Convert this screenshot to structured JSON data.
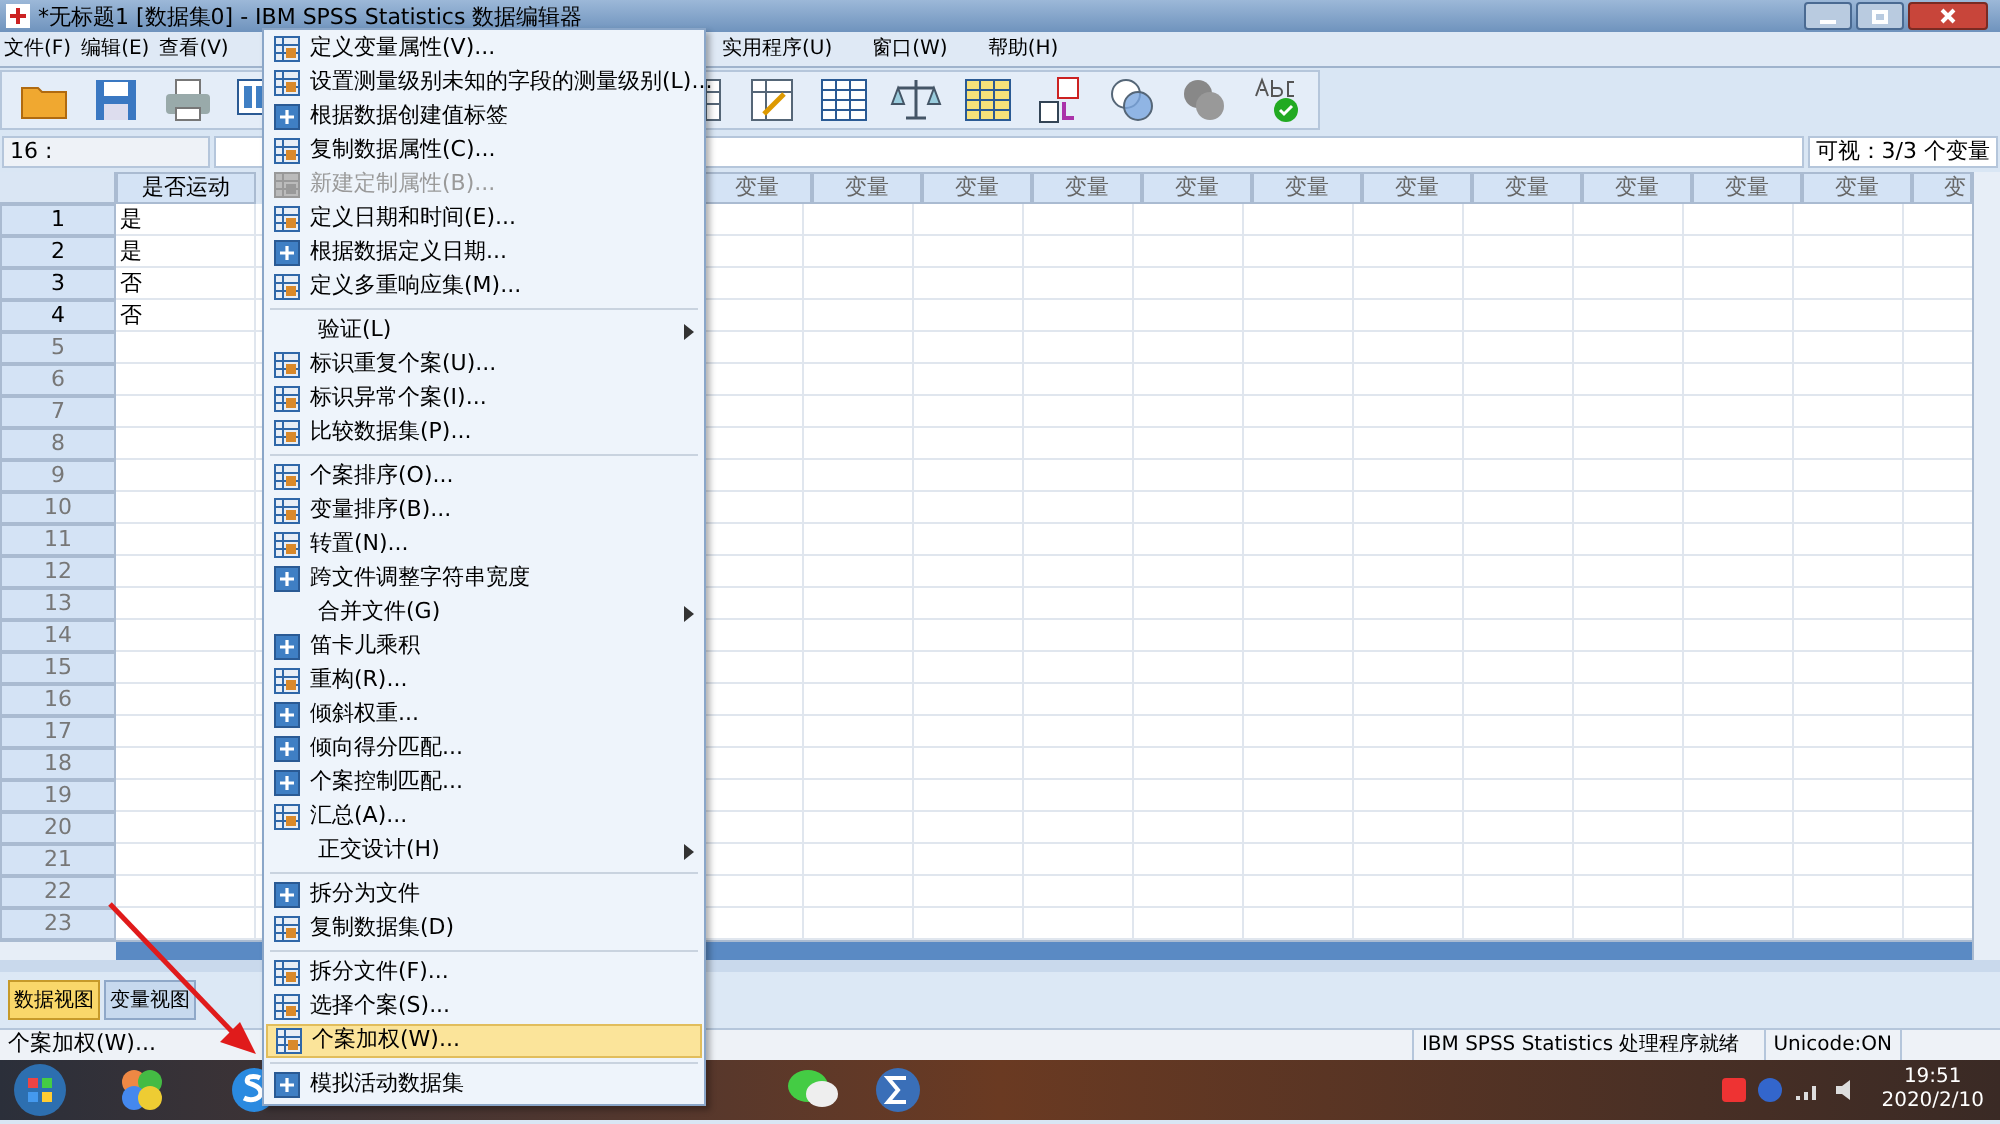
{
  "window": {
    "title": "*无标题1 [数据集0] - IBM SPSS Statistics 数据编辑器"
  },
  "menubar": {
    "left": [
      {
        "label": "文件(F)"
      },
      {
        "label": "编辑(E)"
      },
      {
        "label": "查看(V)"
      }
    ],
    "right": [
      {
        "label": "实用程序(U)"
      },
      {
        "label": "窗口(W)"
      },
      {
        "label": "帮助(H)"
      }
    ]
  },
  "cell_bar": {
    "reference": "16 :",
    "visible": "可视：3/3 个变量"
  },
  "grid": {
    "first_column": "是否运动",
    "columns": [
      "变量",
      "变量",
      "变量",
      "变量",
      "变量",
      "变量",
      "变量",
      "变量",
      "变量",
      "变量",
      "变量",
      "变"
    ],
    "row_numbers": [
      "1",
      "2",
      "3",
      "4",
      "5",
      "6",
      "7",
      "8",
      "9",
      "10",
      "11",
      "12",
      "13",
      "14",
      "15",
      "16",
      "17",
      "18",
      "19",
      "20",
      "21",
      "22",
      "23"
    ],
    "values": [
      "是",
      "是",
      "否",
      "否"
    ]
  },
  "view_tabs": [
    {
      "label": "数据视图",
      "selected": true
    },
    {
      "label": "变量视图",
      "selected": false
    }
  ],
  "status_bar": {
    "left": "个案加权(W)...",
    "processor": "IBM SPSS Statistics 处理程序就绪",
    "unicode": "Unicode:ON"
  },
  "menu": {
    "items": [
      {
        "kind": "tool",
        "label": "定义变量属性(V)...",
        "disabled": false,
        "selected": false
      },
      {
        "kind": "tool",
        "label": "设置测量级别未知的字段的测量级别(L)...",
        "disabled": false,
        "selected": false
      },
      {
        "kind": "plus",
        "label": "根据数据创建值标签",
        "disabled": false,
        "selected": false
      },
      {
        "kind": "tool",
        "label": "复制数据属性(C)...",
        "disabled": false,
        "selected": false
      },
      {
        "kind": "tool",
        "label": "新建定制属性(B)...",
        "disabled": true,
        "selected": false
      },
      {
        "kind": "tool",
        "label": "定义日期和时间(E)...",
        "disabled": false,
        "selected": false
      },
      {
        "kind": "plus",
        "label": "根据数据定义日期...",
        "disabled": false,
        "selected": false
      },
      {
        "kind": "tool",
        "label": "定义多重响应集(M)...",
        "disabled": false,
        "selected": false
      },
      {
        "kind": "separator"
      },
      {
        "kind": "submenu",
        "label": "验证(L)",
        "disabled": false,
        "selected": false
      },
      {
        "kind": "tool",
        "label": "标识重复个案(U)...",
        "disabled": false,
        "selected": false
      },
      {
        "kind": "tool",
        "label": "标识异常个案(I)...",
        "disabled": false,
        "selected": false
      },
      {
        "kind": "tool",
        "label": "比较数据集(P)...",
        "disabled": false,
        "selected": false
      },
      {
        "kind": "separator"
      },
      {
        "kind": "tool",
        "label": "个案排序(O)...",
        "disabled": false,
        "selected": false
      },
      {
        "kind": "tool",
        "label": "变量排序(B)...",
        "disabled": false,
        "selected": false
      },
      {
        "kind": "tool",
        "label": "转置(N)...",
        "disabled": false,
        "selected": false
      },
      {
        "kind": "plus",
        "label": "跨文件调整字符串宽度",
        "disabled": false,
        "selected": false
      },
      {
        "kind": "submenu",
        "label": "合并文件(G)",
        "disabled": false,
        "selected": false
      },
      {
        "kind": "plus",
        "label": "笛卡儿乘积",
        "disabled": false,
        "selected": false
      },
      {
        "kind": "tool",
        "label": "重构(R)...",
        "disabled": false,
        "selected": false
      },
      {
        "kind": "plus",
        "label": "倾斜权重...",
        "disabled": false,
        "selected": false
      },
      {
        "kind": "plus",
        "label": "倾向得分匹配...",
        "disabled": false,
        "selected": false
      },
      {
        "kind": "plus",
        "label": "个案控制匹配...",
        "disabled": false,
        "selected": false
      },
      {
        "kind": "tool",
        "label": "汇总(A)...",
        "disabled": false,
        "selected": false
      },
      {
        "kind": "submenu",
        "label": "正交设计(H)",
        "disabled": false,
        "selected": false
      },
      {
        "kind": "separator"
      },
      {
        "kind": "plus",
        "label": "拆分为文件",
        "disabled": false,
        "selected": false
      },
      {
        "kind": "tool",
        "label": "复制数据集(D)",
        "disabled": false,
        "selected": false
      },
      {
        "kind": "separator"
      },
      {
        "kind": "tool",
        "label": "拆分文件(F)...",
        "disabled": false,
        "selected": false
      },
      {
        "kind": "tool",
        "label": "选择个案(S)...",
        "disabled": false,
        "selected": false
      },
      {
        "kind": "tool",
        "label": "个案加权(W)...",
        "disabled": false,
        "selected": true
      },
      {
        "kind": "separator"
      },
      {
        "kind": "plus",
        "label": "模拟活动数据集",
        "disabled": false,
        "selected": false
      }
    ]
  },
  "taskbar": {
    "time": "19:51",
    "date": "2020/2/10"
  }
}
